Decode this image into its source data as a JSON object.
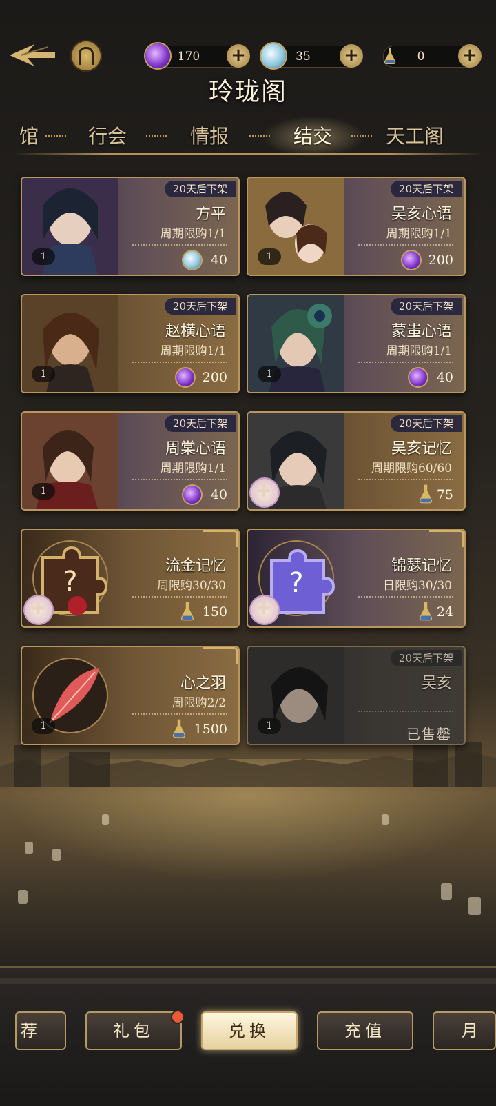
{
  "header": {
    "title": "玲珑阁",
    "currencies": [
      {
        "icon": "purple-gem-icon",
        "value": "170"
      },
      {
        "icon": "blue-pearl-icon",
        "value": "35"
      },
      {
        "icon": "flask-icon",
        "value": "0"
      }
    ]
  },
  "tabs": [
    {
      "label": "馆"
    },
    {
      "label": "行会"
    },
    {
      "label": "情报"
    },
    {
      "label": "结交",
      "active": true
    },
    {
      "label": "天工阁"
    }
  ],
  "items": [
    {
      "badge": "20天后下架",
      "name": "方平",
      "limit": "周期限购1/1",
      "qty": "1",
      "price": "40",
      "price_icon": "blue-pearl-icon"
    },
    {
      "badge": "20天后下架",
      "name": "吴亥心语",
      "limit": "周期限购1/1",
      "qty": "1",
      "price": "200",
      "price_icon": "purple-gem-icon"
    },
    {
      "badge": "20天后下架",
      "name": "赵横心语",
      "limit": "周期限购1/1",
      "qty": "1",
      "price": "200",
      "price_icon": "purple-gem-icon"
    },
    {
      "badge": "20天后下架",
      "name": "蒙蚩心语",
      "limit": "周期限购1/1",
      "qty": "1",
      "price": "40",
      "price_icon": "purple-gem-icon"
    },
    {
      "badge": "20天后下架",
      "name": "周棠心语",
      "limit": "周期限购1/1",
      "qty": "1",
      "price": "40",
      "price_icon": "purple-gem-icon"
    },
    {
      "badge": "20天后下架",
      "name": "吴亥记忆",
      "limit": "周期限购60/60",
      "price": "75",
      "price_icon": "flask-icon"
    },
    {
      "name": "流金记忆",
      "limit": "周限购30/30",
      "price": "150",
      "price_icon": "flask-icon"
    },
    {
      "name": "锦瑟记忆",
      "limit": "日限购30/30",
      "price": "24",
      "price_icon": "flask-icon"
    },
    {
      "name": "心之羽",
      "limit": "周限购2/2",
      "qty": "1",
      "price": "1500",
      "price_icon": "flask-icon"
    },
    {
      "badge": "20天后下架",
      "name": "吴亥",
      "qty": "1",
      "status": "已售罄"
    }
  ],
  "bottom_nav": [
    {
      "label": "荐"
    },
    {
      "label": "礼包",
      "notification": true
    },
    {
      "label": "兑换",
      "active": true
    },
    {
      "label": "充值"
    },
    {
      "label": "月"
    }
  ],
  "colors": {
    "accent_gold": "#b9975d",
    "purple_currency": "#7a2fc9",
    "blue_currency": "#8fc8e0",
    "notification": "#e85a38"
  }
}
